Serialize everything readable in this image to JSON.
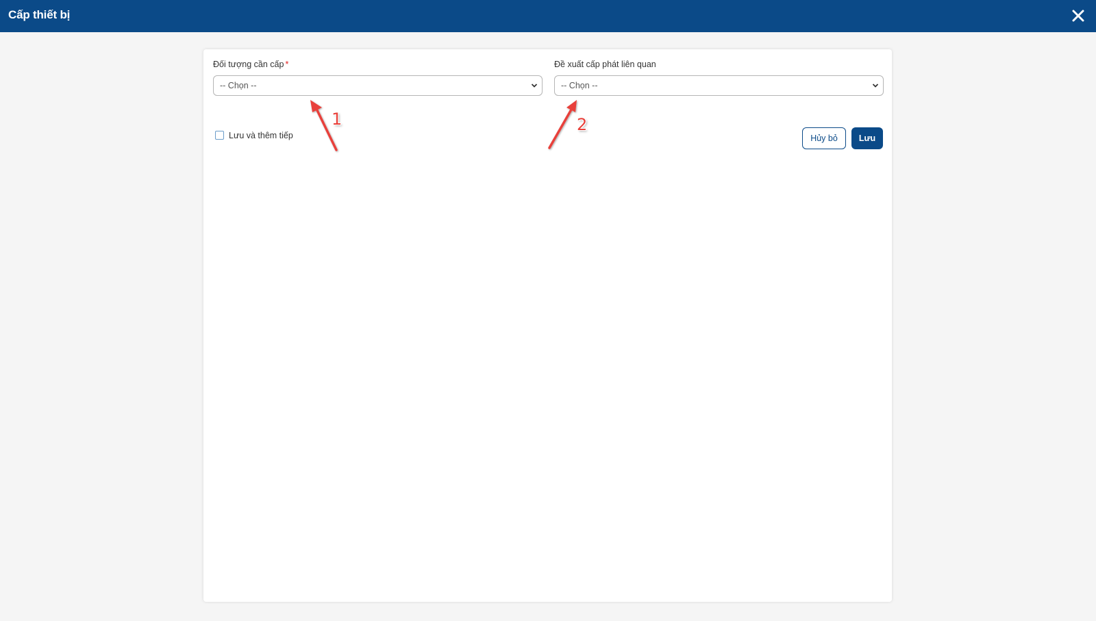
{
  "window": {
    "title": "Cấp thiết bị",
    "close_icon": "close-icon"
  },
  "colors": {
    "primary": "#0b4a88",
    "required": "#e02020",
    "annotation": "#e8403a"
  },
  "form": {
    "field1": {
      "label": "Đối tượng cần cấp",
      "required_mark": "*",
      "value": "-- Chọn --"
    },
    "field2": {
      "label": "Đề xuất cấp phát liên quan",
      "value": "-- Chọn --"
    },
    "save_and_continue": {
      "label": "Lưu và thêm tiếp",
      "checked": false
    },
    "cancel_label": "Hủy bỏ",
    "save_label": "Lưu"
  },
  "annotations": {
    "marker1": "1",
    "marker2": "2"
  }
}
